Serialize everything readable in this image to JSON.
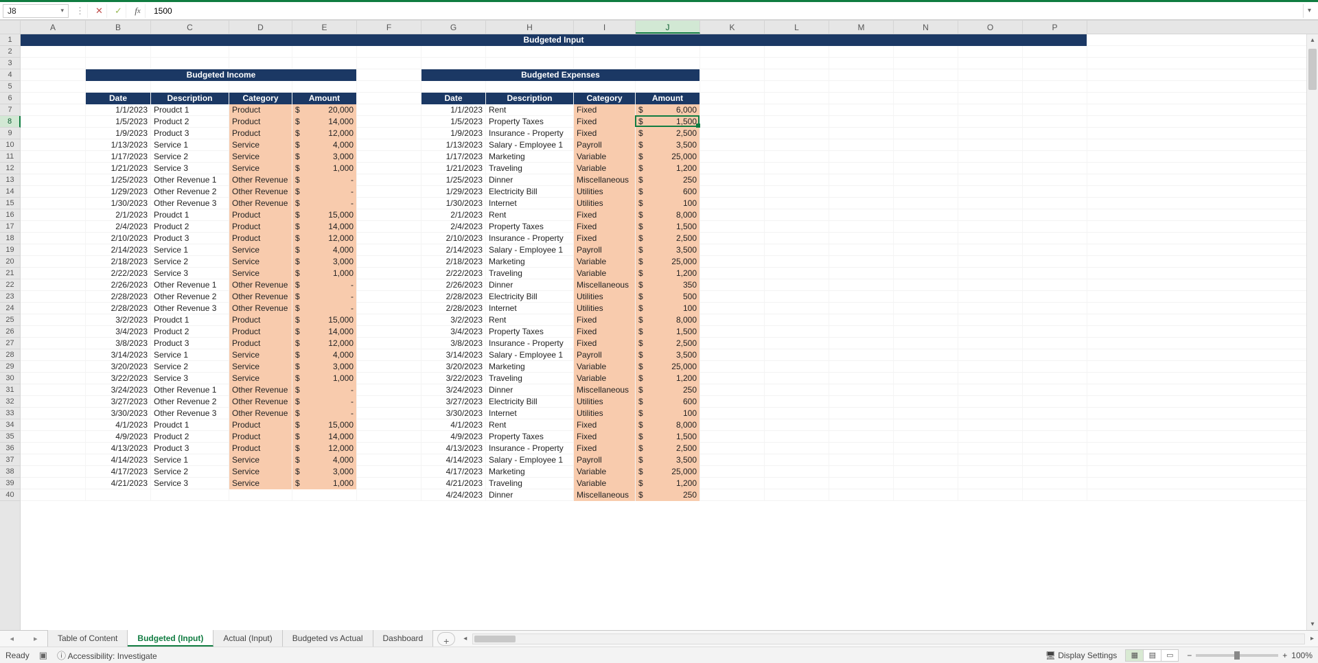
{
  "formula_bar": {
    "name_box": "J8",
    "value": "1500"
  },
  "columns": [
    "A",
    "B",
    "C",
    "D",
    "E",
    "F",
    "G",
    "H",
    "I",
    "J",
    "K",
    "L",
    "M",
    "N",
    "O",
    "P"
  ],
  "selected_col": "J",
  "selected_row": 8,
  "titles": {
    "page": "Budgeted Input",
    "income": "Budgeted Income",
    "expenses": "Budgeted Expenses",
    "hdr_date": "Date",
    "hdr_desc": "Description",
    "hdr_cat": "Category",
    "hdr_amt": "Amount"
  },
  "income_rows": [
    {
      "date": "1/1/2023",
      "desc": "Proudct 1",
      "cat": "Product",
      "amt": "20,000"
    },
    {
      "date": "1/5/2023",
      "desc": "Product 2",
      "cat": "Product",
      "amt": "14,000"
    },
    {
      "date": "1/9/2023",
      "desc": "Product 3",
      "cat": "Product",
      "amt": "12,000"
    },
    {
      "date": "1/13/2023",
      "desc": "Service 1",
      "cat": "Service",
      "amt": "4,000"
    },
    {
      "date": "1/17/2023",
      "desc": "Service 2",
      "cat": "Service",
      "amt": "3,000"
    },
    {
      "date": "1/21/2023",
      "desc": "Service 3",
      "cat": "Service",
      "amt": "1,000"
    },
    {
      "date": "1/25/2023",
      "desc": "Other Revenue 1",
      "cat": "Other Revenue",
      "amt": "-"
    },
    {
      "date": "1/29/2023",
      "desc": "Other Revenue 2",
      "cat": "Other Revenue",
      "amt": "-"
    },
    {
      "date": "1/30/2023",
      "desc": "Other Revenue 3",
      "cat": "Other Revenue",
      "amt": "-"
    },
    {
      "date": "2/1/2023",
      "desc": "Proudct 1",
      "cat": "Product",
      "amt": "15,000"
    },
    {
      "date": "2/4/2023",
      "desc": "Product 2",
      "cat": "Product",
      "amt": "14,000"
    },
    {
      "date": "2/10/2023",
      "desc": "Product 3",
      "cat": "Product",
      "amt": "12,000"
    },
    {
      "date": "2/14/2023",
      "desc": "Service 1",
      "cat": "Service",
      "amt": "4,000"
    },
    {
      "date": "2/18/2023",
      "desc": "Service 2",
      "cat": "Service",
      "amt": "3,000"
    },
    {
      "date": "2/22/2023",
      "desc": "Service 3",
      "cat": "Service",
      "amt": "1,000"
    },
    {
      "date": "2/26/2023",
      "desc": "Other Revenue 1",
      "cat": "Other Revenue",
      "amt": "-"
    },
    {
      "date": "2/28/2023",
      "desc": "Other Revenue 2",
      "cat": "Other Revenue",
      "amt": "-"
    },
    {
      "date": "2/28/2023",
      "desc": "Other Revenue 3",
      "cat": "Other Revenue",
      "amt": "-"
    },
    {
      "date": "3/2/2023",
      "desc": "Proudct 1",
      "cat": "Product",
      "amt": "15,000"
    },
    {
      "date": "3/4/2023",
      "desc": "Product 2",
      "cat": "Product",
      "amt": "14,000"
    },
    {
      "date": "3/8/2023",
      "desc": "Product 3",
      "cat": "Product",
      "amt": "12,000"
    },
    {
      "date": "3/14/2023",
      "desc": "Service 1",
      "cat": "Service",
      "amt": "4,000"
    },
    {
      "date": "3/20/2023",
      "desc": "Service 2",
      "cat": "Service",
      "amt": "3,000"
    },
    {
      "date": "3/22/2023",
      "desc": "Service 3",
      "cat": "Service",
      "amt": "1,000"
    },
    {
      "date": "3/24/2023",
      "desc": "Other Revenue 1",
      "cat": "Other Revenue",
      "amt": "-"
    },
    {
      "date": "3/27/2023",
      "desc": "Other Revenue 2",
      "cat": "Other Revenue",
      "amt": "-"
    },
    {
      "date": "3/30/2023",
      "desc": "Other Revenue 3",
      "cat": "Other Revenue",
      "amt": "-"
    },
    {
      "date": "4/1/2023",
      "desc": "Proudct 1",
      "cat": "Product",
      "amt": "15,000"
    },
    {
      "date": "4/9/2023",
      "desc": "Product 2",
      "cat": "Product",
      "amt": "14,000"
    },
    {
      "date": "4/13/2023",
      "desc": "Product 3",
      "cat": "Product",
      "amt": "12,000"
    },
    {
      "date": "4/14/2023",
      "desc": "Service 1",
      "cat": "Service",
      "amt": "4,000"
    },
    {
      "date": "4/17/2023",
      "desc": "Service 2",
      "cat": "Service",
      "amt": "3,000"
    },
    {
      "date": "4/21/2023",
      "desc": "Service 3",
      "cat": "Service",
      "amt": "1,000"
    }
  ],
  "expense_rows": [
    {
      "date": "1/1/2023",
      "desc": "Rent",
      "cat": "Fixed",
      "amt": "6,000"
    },
    {
      "date": "1/5/2023",
      "desc": "Property Taxes",
      "cat": "Fixed",
      "amt": "1,500"
    },
    {
      "date": "1/9/2023",
      "desc": "Insurance - Property",
      "cat": "Fixed",
      "amt": "2,500"
    },
    {
      "date": "1/13/2023",
      "desc": "Salary - Employee 1",
      "cat": "Payroll",
      "amt": "3,500"
    },
    {
      "date": "1/17/2023",
      "desc": "Marketing",
      "cat": "Variable",
      "amt": "25,000"
    },
    {
      "date": "1/21/2023",
      "desc": "Traveling",
      "cat": "Variable",
      "amt": "1,200"
    },
    {
      "date": "1/25/2023",
      "desc": "Dinner",
      "cat": "Miscellaneous",
      "amt": "250"
    },
    {
      "date": "1/29/2023",
      "desc": "Electricity Bill",
      "cat": "Utilities",
      "amt": "600"
    },
    {
      "date": "1/30/2023",
      "desc": "Internet",
      "cat": "Utilities",
      "amt": "100"
    },
    {
      "date": "2/1/2023",
      "desc": "Rent",
      "cat": "Fixed",
      "amt": "8,000"
    },
    {
      "date": "2/4/2023",
      "desc": "Property Taxes",
      "cat": "Fixed",
      "amt": "1,500"
    },
    {
      "date": "2/10/2023",
      "desc": "Insurance - Property",
      "cat": "Fixed",
      "amt": "2,500"
    },
    {
      "date": "2/14/2023",
      "desc": "Salary - Employee 1",
      "cat": "Payroll",
      "amt": "3,500"
    },
    {
      "date": "2/18/2023",
      "desc": "Marketing",
      "cat": "Variable",
      "amt": "25,000"
    },
    {
      "date": "2/22/2023",
      "desc": "Traveling",
      "cat": "Variable",
      "amt": "1,200"
    },
    {
      "date": "2/26/2023",
      "desc": "Dinner",
      "cat": "Miscellaneous",
      "amt": "350"
    },
    {
      "date": "2/28/2023",
      "desc": "Electricity Bill",
      "cat": "Utilities",
      "amt": "500"
    },
    {
      "date": "2/28/2023",
      "desc": "Internet",
      "cat": "Utilities",
      "amt": "100"
    },
    {
      "date": "3/2/2023",
      "desc": "Rent",
      "cat": "Fixed",
      "amt": "8,000"
    },
    {
      "date": "3/4/2023",
      "desc": "Property Taxes",
      "cat": "Fixed",
      "amt": "1,500"
    },
    {
      "date": "3/8/2023",
      "desc": "Insurance - Property",
      "cat": "Fixed",
      "amt": "2,500"
    },
    {
      "date": "3/14/2023",
      "desc": "Salary - Employee 1",
      "cat": "Payroll",
      "amt": "3,500"
    },
    {
      "date": "3/20/2023",
      "desc": "Marketing",
      "cat": "Variable",
      "amt": "25,000"
    },
    {
      "date": "3/22/2023",
      "desc": "Traveling",
      "cat": "Variable",
      "amt": "1,200"
    },
    {
      "date": "3/24/2023",
      "desc": "Dinner",
      "cat": "Miscellaneous",
      "amt": "250"
    },
    {
      "date": "3/27/2023",
      "desc": "Electricity Bill",
      "cat": "Utilities",
      "amt": "600"
    },
    {
      "date": "3/30/2023",
      "desc": "Internet",
      "cat": "Utilities",
      "amt": "100"
    },
    {
      "date": "4/1/2023",
      "desc": "Rent",
      "cat": "Fixed",
      "amt": "8,000"
    },
    {
      "date": "4/9/2023",
      "desc": "Property Taxes",
      "cat": "Fixed",
      "amt": "1,500"
    },
    {
      "date": "4/13/2023",
      "desc": "Insurance - Property",
      "cat": "Fixed",
      "amt": "2,500"
    },
    {
      "date": "4/14/2023",
      "desc": "Salary - Employee 1",
      "cat": "Payroll",
      "amt": "3,500"
    },
    {
      "date": "4/17/2023",
      "desc": "Marketing",
      "cat": "Variable",
      "amt": "25,000"
    },
    {
      "date": "4/21/2023",
      "desc": "Traveling",
      "cat": "Variable",
      "amt": "1,200"
    },
    {
      "date": "4/24/2023",
      "desc": "Dinner",
      "cat": "Miscellaneous",
      "amt": "250"
    }
  ],
  "sheet_tabs": [
    "Table of Content",
    "Budgeted (Input)",
    "Actual (Input)",
    "Budgeted vs Actual",
    "Dashboard"
  ],
  "active_sheet": 1,
  "status": {
    "ready": "Ready",
    "accessibility": "Accessibility: Investigate",
    "display": "Display Settings",
    "zoom": "100%"
  },
  "col_widths": {
    "A": 95,
    "B": 95,
    "C": 114,
    "D": 92,
    "E": 94,
    "F": 94,
    "G": 94,
    "H": 128,
    "I": 90,
    "J": 94,
    "K": 94,
    "L": 94,
    "M": 94,
    "N": 94,
    "O": 94,
    "P": 94
  }
}
